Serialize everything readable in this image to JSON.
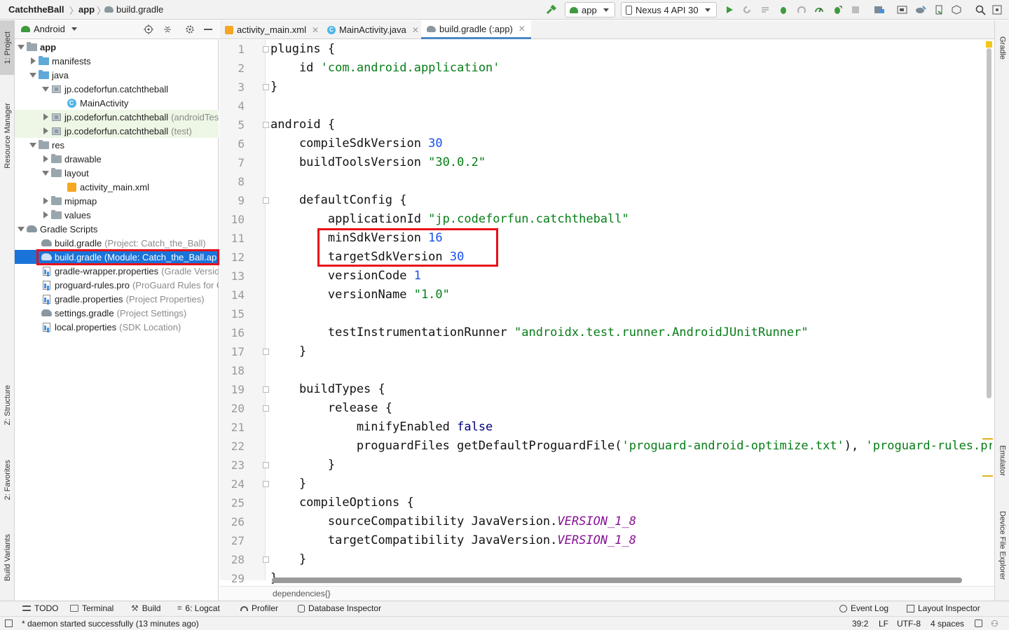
{
  "toolbar": {
    "breadcrumb": [
      "CatchtheBall",
      "app",
      "build.gradle"
    ],
    "run_config": "app",
    "device": "Nexus 4 API 30"
  },
  "left_strip": {
    "tabs": [
      "1: Project",
      "Resource Manager",
      "Z: Structure",
      "2: Favorites",
      "Build Variants"
    ]
  },
  "project_panel": {
    "view_selector": "Android",
    "tree": [
      {
        "label": "app",
        "hint": ""
      },
      {
        "label": "manifests",
        "hint": ""
      },
      {
        "label": "java",
        "hint": ""
      },
      {
        "label": "jp.codeforfun.catchtheball",
        "hint": ""
      },
      {
        "label": "MainActivity",
        "hint": ""
      },
      {
        "label": "jp.codeforfun.catchtheball",
        "hint": "(androidTest)"
      },
      {
        "label": "jp.codeforfun.catchtheball",
        "hint": "(test)"
      },
      {
        "label": "res",
        "hint": ""
      },
      {
        "label": "drawable",
        "hint": ""
      },
      {
        "label": "layout",
        "hint": ""
      },
      {
        "label": "activity_main.xml",
        "hint": ""
      },
      {
        "label": "mipmap",
        "hint": ""
      },
      {
        "label": "values",
        "hint": ""
      },
      {
        "label": "Gradle Scripts",
        "hint": ""
      },
      {
        "label": "build.gradle",
        "hint": "(Project: Catch_the_Ball)"
      },
      {
        "label": "build.gradle (Module: Catch_the_Ball.app)",
        "hint": ""
      },
      {
        "label": "gradle-wrapper.properties",
        "hint": "(Gradle Version)"
      },
      {
        "label": "proguard-rules.pro",
        "hint": "(ProGuard Rules for Catch_the_Ball.app)"
      },
      {
        "label": "gradle.properties",
        "hint": "(Project Properties)"
      },
      {
        "label": "settings.gradle",
        "hint": "(Project Settings)"
      },
      {
        "label": "local.properties",
        "hint": "(SDK Location)"
      }
    ]
  },
  "editor": {
    "tabs": [
      "activity_main.xml",
      "MainActivity.java",
      "build.gradle (:app)"
    ],
    "line_numbers": [
      "1",
      "2",
      "3",
      "4",
      "5",
      "6",
      "7",
      "8",
      "9",
      "10",
      "11",
      "12",
      "13",
      "14",
      "15",
      "16",
      "17",
      "18",
      "19",
      "20",
      "21",
      "22",
      "23",
      "24",
      "25",
      "26",
      "27",
      "28",
      "29"
    ],
    "code": {
      "l1": "plugins {",
      "l2a": "    id ",
      "l2b": "'com.android.application'",
      "l3": "}",
      "l5": "android {",
      "l6a": "    compileSdkVersion ",
      "l6b": "30",
      "l7a": "    buildToolsVersion ",
      "l7b": "\"30.0.2\"",
      "l9": "    defaultConfig {",
      "l10a": "        applicationId ",
      "l10b": "\"jp.codeforfun.catchtheball\"",
      "l11a": "        minSdkVersion ",
      "l11b": "16",
      "l12a": "        targetSdkVersion ",
      "l12b": "30",
      "l13a": "        versionCode ",
      "l13b": "1",
      "l14a": "        versionName ",
      "l14b": "\"1.0\"",
      "l16a": "        testInstrumentationRunner ",
      "l16b": "\"androidx.test.runner.AndroidJUnitRunner\"",
      "l17": "    }",
      "l19": "    buildTypes {",
      "l20": "        release {",
      "l21a": "            minifyEnabled ",
      "l21b": "false",
      "l22a": "            proguardFiles getDefaultProguardFile(",
      "l22b": "'proguard-android-optimize.txt'",
      "l22c": "), ",
      "l22d": "'proguard-rules.pro'",
      "l23": "        }",
      "l24": "    }",
      "l25": "    compileOptions {",
      "l26a": "        sourceCompatibility JavaVersion.",
      "l26b": "VERSION_1_8",
      "l27a": "        targetCompatibility JavaVersion.",
      "l27b": "VERSION_1_8",
      "l28": "    }",
      "l29": "}"
    },
    "breadcrumb": "dependencies{}"
  },
  "right_strip": {
    "tabs": [
      "Gradle",
      "Emulator",
      "Device File Explorer"
    ]
  },
  "bottom_tools": {
    "left": [
      "TODO",
      "Terminal",
      "Build",
      "6: Logcat",
      "Profiler",
      "Database Inspector"
    ],
    "right": [
      "Event Log",
      "Layout Inspector"
    ]
  },
  "status": {
    "message": "* daemon started successfully (13 minutes ago)",
    "position": "39:2",
    "line_sep": "LF",
    "encoding": "UTF-8",
    "indent": "4 spaces"
  },
  "colors": {
    "selection": "#1a73d9",
    "highlight_box": "#e8101b",
    "string": "#067d17",
    "number": "#1750eb",
    "keyword": "#000080",
    "constant": "#871094"
  }
}
